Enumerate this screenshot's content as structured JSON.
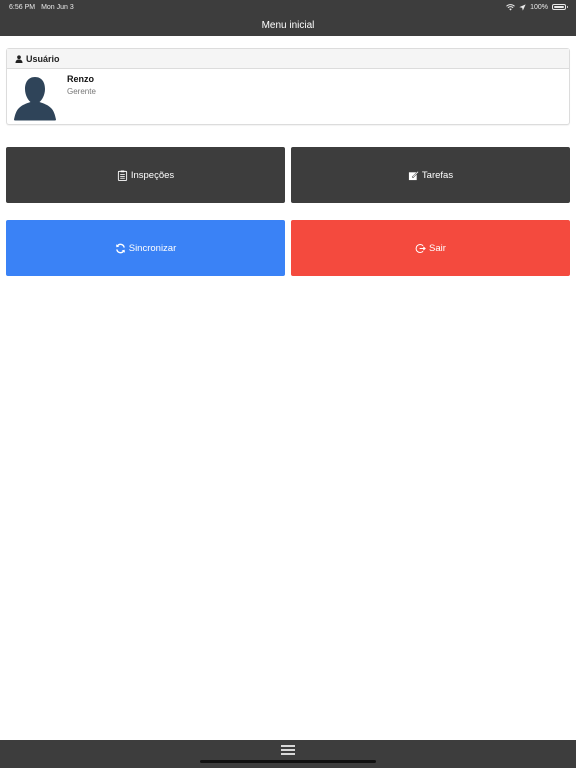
{
  "status_bar": {
    "time": "6:56 PM",
    "date": "Mon Jun 3",
    "battery": "100%"
  },
  "navbar": {
    "title": "Menu inicial"
  },
  "user_card": {
    "header": "Usuário",
    "name": "Renzo",
    "role": "Gerente"
  },
  "buttons": {
    "inspections": "Inspeções",
    "tasks": "Tarefas",
    "sync": "Sincronizar",
    "logout": "Sair"
  },
  "colors": {
    "dark": "#3d3d3d",
    "blue": "#3a82f6",
    "red": "#f44a3e",
    "avatar": "#2f4459"
  }
}
